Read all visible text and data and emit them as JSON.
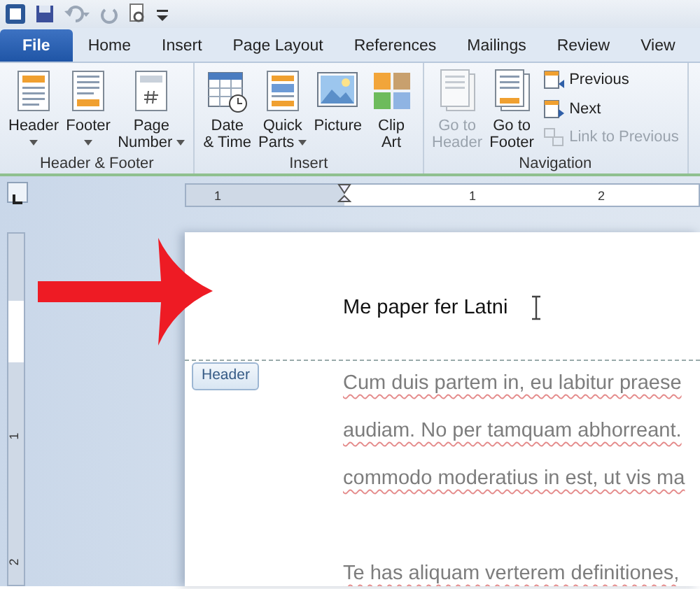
{
  "tabs": [
    {
      "label": "File",
      "kind": "file",
      "selected": false
    },
    {
      "label": "Home",
      "kind": "tab",
      "selected": false
    },
    {
      "label": "Insert",
      "kind": "tab",
      "selected": false
    },
    {
      "label": "Page Layout",
      "kind": "tab",
      "selected": false
    },
    {
      "label": "References",
      "kind": "tab",
      "selected": false
    },
    {
      "label": "Mailings",
      "kind": "tab",
      "selected": false
    },
    {
      "label": "Review",
      "kind": "tab",
      "selected": false
    },
    {
      "label": "View",
      "kind": "tab",
      "selected": false
    }
  ],
  "ribbon_groups": [
    {
      "label": "Header & Footer",
      "buttons": [
        {
          "kind": "large",
          "lines": [
            "Header"
          ],
          "dropdown": true,
          "disabled": false
        },
        {
          "kind": "large",
          "lines": [
            "Footer"
          ],
          "dropdown": true,
          "disabled": false
        },
        {
          "kind": "large",
          "lines": [
            "Page",
            "Number"
          ],
          "dropdown": true,
          "disabled": false
        }
      ]
    },
    {
      "label": "Insert",
      "buttons": [
        {
          "kind": "large",
          "lines": [
            "Date",
            "& Time"
          ],
          "dropdown": false,
          "disabled": false
        },
        {
          "kind": "large",
          "lines": [
            "Quick",
            "Parts"
          ],
          "dropdown": true,
          "disabled": false
        },
        {
          "kind": "large",
          "lines": [
            "Picture"
          ],
          "dropdown": false,
          "disabled": false
        },
        {
          "kind": "large",
          "lines": [
            "Clip",
            "Art"
          ],
          "dropdown": false,
          "disabled": false
        }
      ]
    },
    {
      "label": "Navigation",
      "buttons": [
        {
          "kind": "large",
          "lines": [
            "Go to",
            "Header"
          ],
          "dropdown": false,
          "disabled": true
        },
        {
          "kind": "large",
          "lines": [
            "Go to",
            "Footer"
          ],
          "dropdown": false,
          "disabled": false
        },
        {
          "kind": "small",
          "lines": [
            "Previous"
          ],
          "disabled": false
        },
        {
          "kind": "small",
          "lines": [
            "Next"
          ],
          "disabled": false
        },
        {
          "kind": "small",
          "lines": [
            "Link to Previous"
          ],
          "disabled": true
        }
      ]
    }
  ],
  "ruler": {
    "horizontal_marks": [
      "1",
      "1",
      "2"
    ],
    "vertical_marks": [
      "1",
      "2"
    ]
  },
  "document": {
    "header_text": "Me paper fer Latni",
    "header_tag": "Header",
    "paragraphs": [
      [
        "Cum duis partem in, eu labitur praese",
        "audiam. No per tamquam abhorreant.",
        "commodo moderatius in est, ut vis ma"
      ],
      [
        "Te has aliquam verterem definitiones,"
      ]
    ]
  }
}
